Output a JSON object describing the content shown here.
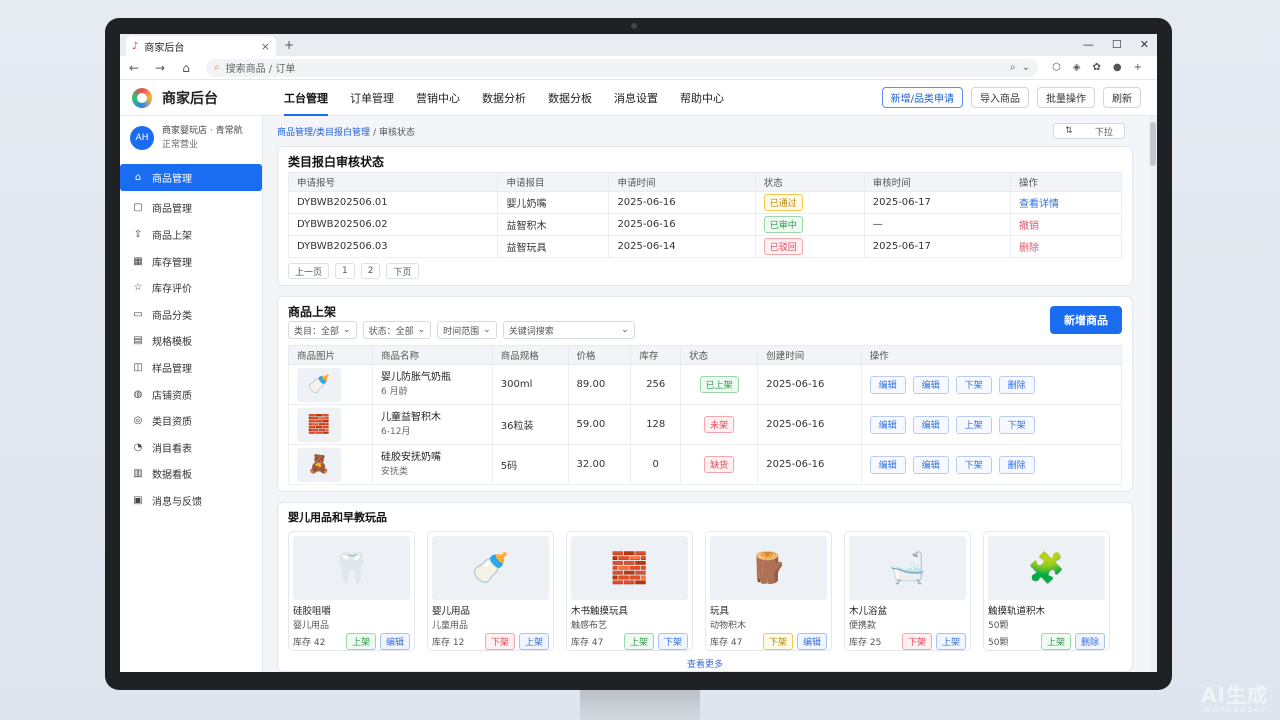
{
  "browser": {
    "tab_title": "商家后台",
    "tab_close": "×",
    "new_tab": "+",
    "address": "搜索商品 / 订单",
    "window_controls": [
      "—",
      "☐",
      "✕"
    ]
  },
  "app": {
    "name": "商家后台",
    "nav": [
      "工台管理",
      "订单管理",
      "营销中心",
      "数据分析",
      "数据分板",
      "消息设置",
      "帮助中心"
    ],
    "header_buttons": [
      "新增/品类申请",
      "导入商品",
      "批量操作",
      "刷新"
    ]
  },
  "store": {
    "avatar_text": "AH",
    "name": "商家婴玩店 · 青常航",
    "status": "正常营业"
  },
  "sidebar": {
    "active": "商品管理",
    "items": [
      "商品管理",
      "商品上架",
      "库存管理",
      "库存评价",
      "商品分类",
      "规格模板",
      "样品管理",
      "店铺资质",
      "类目资质",
      "消目看表",
      "数据看板",
      "消息与反馈"
    ]
  },
  "breadcrumb": {
    "a": "商品管理/",
    "b": "类目报白管理",
    "c": "/ 审核状态",
    "pager_icon": "⇅",
    "pager_label": "下拉"
  },
  "audit": {
    "title": "类目报白审核状态",
    "headers": [
      "申请报号",
      "申请报目",
      "申请时间",
      "状态",
      "审核时间",
      "操作"
    ],
    "rows": [
      {
        "id": "DYBWB202506.01",
        "cat": "婴儿奶嘴",
        "time": "2025-06-16",
        "status": "已通过",
        "tone": "yellow",
        "audit": "2025-06-17",
        "op": "查看详情",
        "op_tone": "blue"
      },
      {
        "id": "DYBWB202506.02",
        "cat": "益智积木",
        "time": "2025-06-16",
        "status": "已审中",
        "tone": "green",
        "audit": "—",
        "op": "撤销",
        "op_tone": "red"
      },
      {
        "id": "DYBWB202506.03",
        "cat": "益智玩具",
        "time": "2025-06-14",
        "status": "已驳回",
        "tone": "red",
        "audit": "2025-06-17",
        "op": "删除",
        "op_tone": "red"
      }
    ],
    "pager": [
      "上一页",
      "1",
      "2",
      "下页"
    ]
  },
  "listing": {
    "title": "商品上架",
    "add_button": "新增商品",
    "filters": [
      "类目：全部",
      "状态：全部",
      "时间范围",
      "关键词搜索"
    ],
    "headers": [
      "商品图片",
      "商品名称",
      "商品规格",
      "价格",
      "库存",
      "状态",
      "创建时间",
      "操作"
    ],
    "rows": [
      {
        "name": "婴儿防胀气奶瓶",
        "sub": "6 月龄",
        "spec": "300ml",
        "price": "89.00",
        "stock": "256",
        "status": "已上架",
        "tone": "green",
        "time": "2025-06-16",
        "ops": [
          "编辑",
          "编辑",
          "下架",
          "删除"
        ]
      },
      {
        "name": "儿童益智积木",
        "sub": "6-12月",
        "spec": "36粒装",
        "price": "59.00",
        "stock": "128",
        "status": "未架",
        "tone": "red",
        "time": "2025-06-16",
        "ops": [
          "编辑",
          "编辑",
          "上架",
          "下架"
        ]
      },
      {
        "name": "硅胶安抚奶嘴",
        "sub": "安抚类",
        "spec": "5码",
        "price": "32.00",
        "stock": "0",
        "status": "缺货",
        "tone": "red",
        "time": "2025-06-16",
        "ops": [
          "编辑",
          "编辑",
          "下架",
          "删除"
        ]
      }
    ]
  },
  "gallery": {
    "title": "婴儿用品和早教玩品",
    "more": "查看更多",
    "items": [
      {
        "name": "硅胶咀嚼",
        "sub": "婴儿用品",
        "stock": "库存 42",
        "tags": [
          [
            "上架",
            "green"
          ],
          [
            "编辑",
            "blue"
          ]
        ]
      },
      {
        "name": "婴儿用品",
        "sub": "儿童用品",
        "stock": "库存 12",
        "tags": [
          [
            "下架",
            "red"
          ],
          [
            "上架",
            "blue"
          ]
        ]
      },
      {
        "name": "木书触摸玩具",
        "sub": "触感布艺",
        "stock": "库存 47",
        "tags": [
          [
            "上架",
            "green"
          ],
          [
            "下架",
            "blue"
          ]
        ]
      },
      {
        "name": "玩具",
        "sub": "动物积木",
        "stock": "库存 47",
        "tags": [
          [
            "下架",
            "yellow"
          ],
          [
            "编辑",
            "blue"
          ]
        ]
      },
      {
        "name": "木儿浴盆",
        "sub": "便携款",
        "stock": "库存 25",
        "tags": [
          [
            "下架",
            "red"
          ],
          [
            "上架",
            "blue"
          ]
        ]
      },
      {
        "name": "触摸轨道积木",
        "sub": "50颗",
        "stock": "50颗",
        "tags": [
          [
            "上架",
            "green"
          ],
          [
            "删除",
            "blue"
          ]
        ]
      }
    ]
  },
  "watermark": {
    "line1": "AI生成",
    "line2": "WORKBUDDY"
  },
  "colors": {
    "accent": "#1a6cf0"
  }
}
